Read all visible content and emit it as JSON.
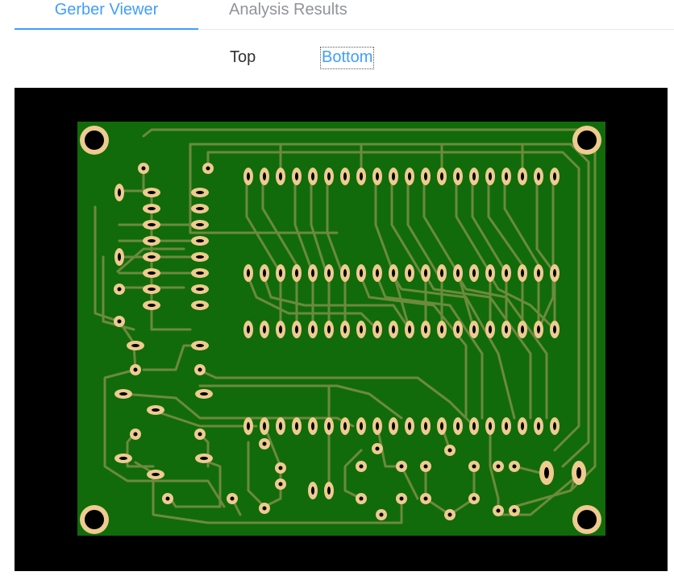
{
  "tabs": {
    "active_label": "Gerber Viewer",
    "inactive_label": "Analysis Results"
  },
  "layer_toggle": {
    "top_label": "Top",
    "bottom_label": "Bottom",
    "selected": "Bottom"
  },
  "viewer": {
    "background_color": "#000000",
    "board_color": "#116b0b",
    "trace_color": "#6d8a3c",
    "pad_color": "#eecb8f",
    "hole_color": "#000000"
  }
}
